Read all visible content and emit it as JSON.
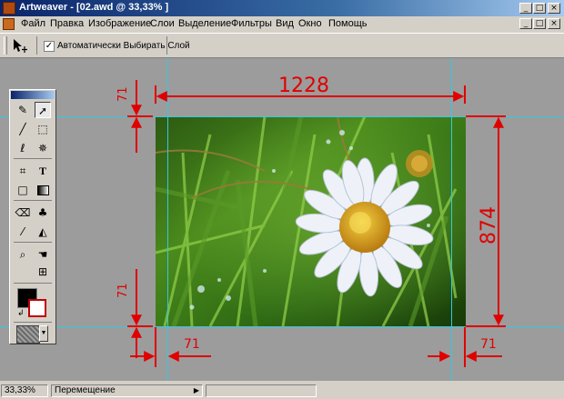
{
  "window": {
    "title": "Artweaver - [02.awd @ 33,33% ]",
    "buttons": {
      "minimize": "_",
      "maximize": "□",
      "close": "×"
    }
  },
  "menu": [
    "Файл",
    "Правка",
    "Изображение",
    "Слои",
    "Выделение",
    "Фильтры",
    "Вид",
    "Окно",
    "Помощь"
  ],
  "toolbar": {
    "auto_select_label": "Автоматически Выбирать Слой",
    "auto_select_checked": "✓"
  },
  "annotations": {
    "width": "1228",
    "height": "874",
    "margin_top": "71",
    "margin_bottom": "71",
    "margin_left": "71",
    "margin_right": "71"
  },
  "status": {
    "zoom": "33,33%",
    "tool": "Перемещение"
  },
  "colors": {
    "accent": "#e00000",
    "guide": "#36c8e0",
    "background_color": "#ffffff",
    "foreground_color": "#000000"
  }
}
